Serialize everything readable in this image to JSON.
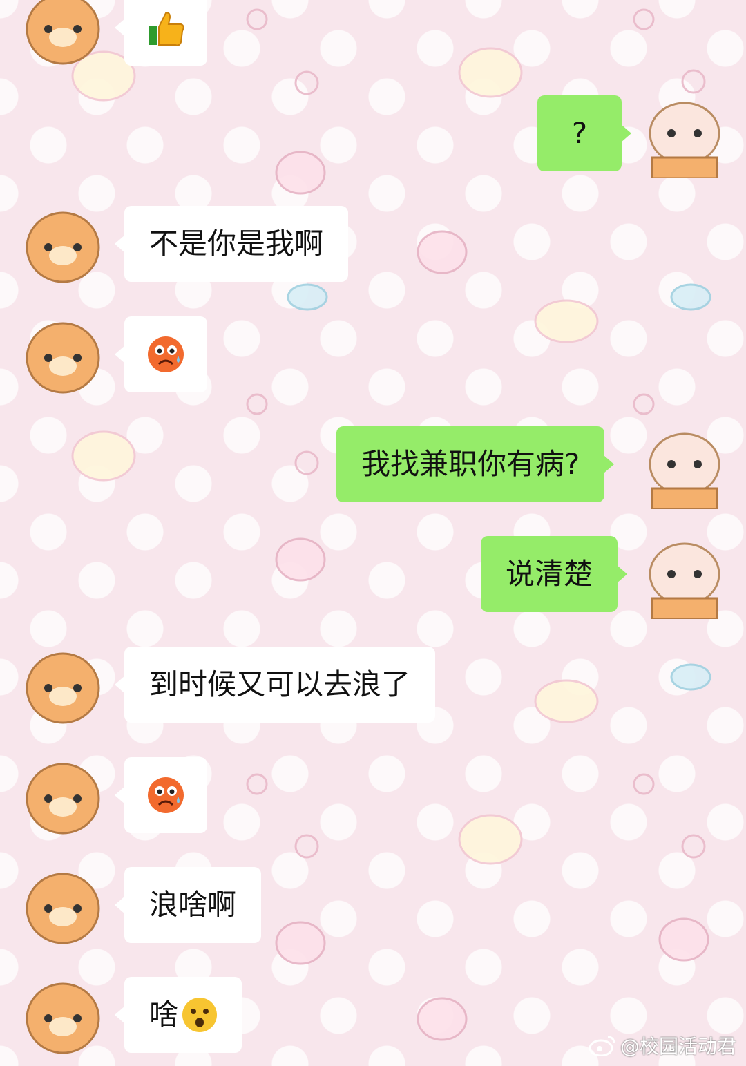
{
  "messages": [
    {
      "side": "in",
      "type": "emoji",
      "icon": "thumbs-up-icon",
      "text": ""
    },
    {
      "side": "out",
      "type": "text",
      "text": "?"
    },
    {
      "side": "in",
      "type": "text",
      "text": "不是你是我啊"
    },
    {
      "side": "in",
      "type": "emoji",
      "icon": "worried-sweat-face-icon",
      "text": ""
    },
    {
      "side": "out",
      "type": "text",
      "text": "我找兼职你有病?"
    },
    {
      "side": "out",
      "type": "text",
      "text": "说清楚"
    },
    {
      "side": "in",
      "type": "text",
      "text": "到时候又可以去浪了"
    },
    {
      "side": "in",
      "type": "emoji",
      "icon": "worried-sweat-face-icon",
      "text": ""
    },
    {
      "side": "in",
      "type": "text",
      "text": "浪啥啊"
    },
    {
      "side": "in",
      "type": "text+emoji",
      "icon": "surprised-face-icon",
      "text": "啥"
    }
  ],
  "watermark": {
    "text": "@校园活动君",
    "icon": "weibo-logo-icon"
  },
  "colors": {
    "outgoing_bubble": "#95ec69",
    "incoming_bubble": "#ffffff",
    "background": "#f8e6ec"
  }
}
